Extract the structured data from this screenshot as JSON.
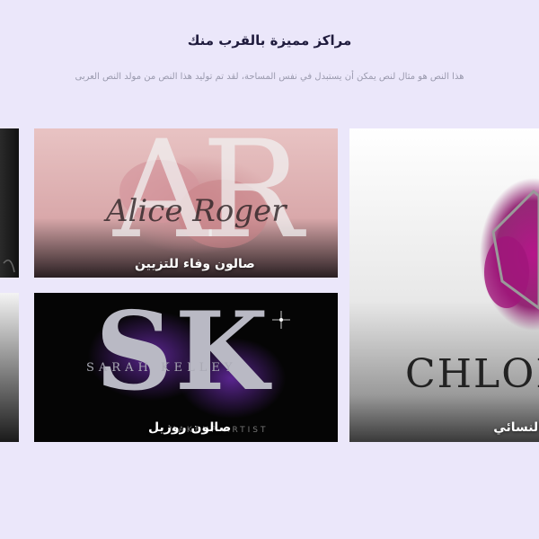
{
  "section": {
    "title": "مراكز مميزة بالقرب منك",
    "subtitle": "هذا النص هو مثال لنص يمكن أن يستبدل في نفس المساحة، لقد تم توليد هذا النص من مولد النص العربى"
  },
  "cards": [
    {
      "label": "صالون وفاء للتزيين",
      "logo_initials": "AR",
      "logo_script": "Alice Roger"
    },
    {
      "label": "صالون روزيل",
      "logo_initials": "SK",
      "logo_name": "SARAH KELLEY",
      "logo_sub": "MAKEUP ARTIST"
    },
    {
      "label": "النسائي",
      "logo_name": "CHLOE"
    }
  ],
  "colors": {
    "page_bg": "#ebe7fa",
    "title": "#1f1b3d",
    "subtitle": "#9a9aae",
    "accent_magenta": "#b5178a",
    "accent_purple": "#5a2590"
  }
}
